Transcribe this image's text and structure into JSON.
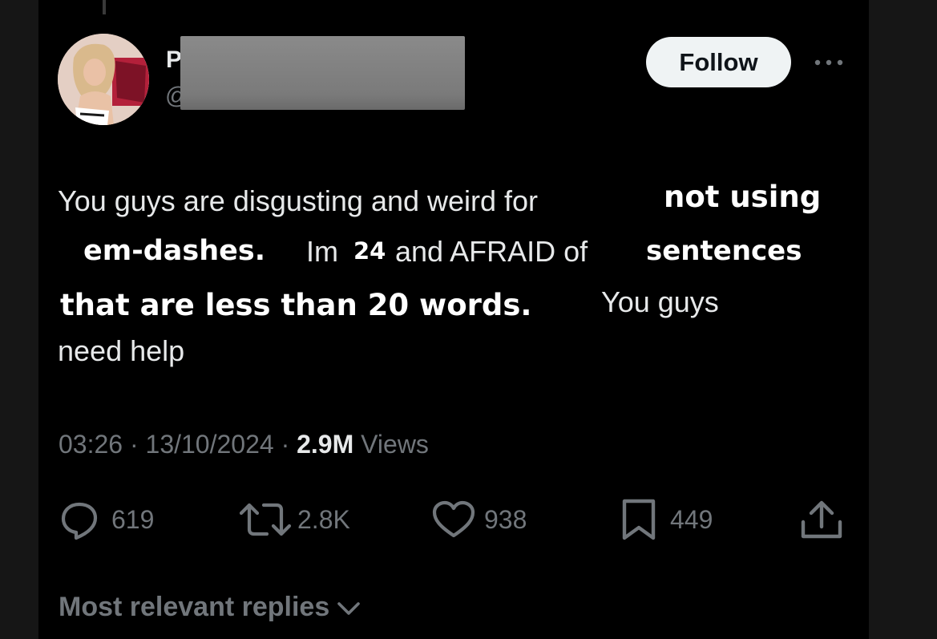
{
  "author": {
    "name_visible": "P",
    "handle_visible": "@"
  },
  "follow_label": "Follow",
  "tweet_text": {
    "line1": "You guys are disgusting and weird for",
    "line2_a": "Im",
    "line2_b": "24",
    "line2_c": "and AFRAID of",
    "line3_tail": "You guys",
    "line4": "need help"
  },
  "stickers": {
    "not_using": "not using",
    "em_dashes": "em-dashes.",
    "sentences": "sentences",
    "less_than": "that are less than 20 words."
  },
  "meta": {
    "time": "03:26",
    "date": "13/10/2024",
    "views_count": "2.9M",
    "views_label": "Views"
  },
  "actions": {
    "replies": "619",
    "reposts": "2.8K",
    "likes": "938",
    "bookmarks": "449"
  },
  "replies_sort_label": "Most relevant replies",
  "icons": [
    "reply-icon",
    "repost-icon",
    "like-icon",
    "bookmark-icon",
    "share-icon",
    "more-icon",
    "chevron-down-icon"
  ],
  "colors": {
    "background": "#000000",
    "text_primary": "#e7e9ea",
    "text_secondary": "#71767b",
    "follow_button": "#eff3f4"
  }
}
